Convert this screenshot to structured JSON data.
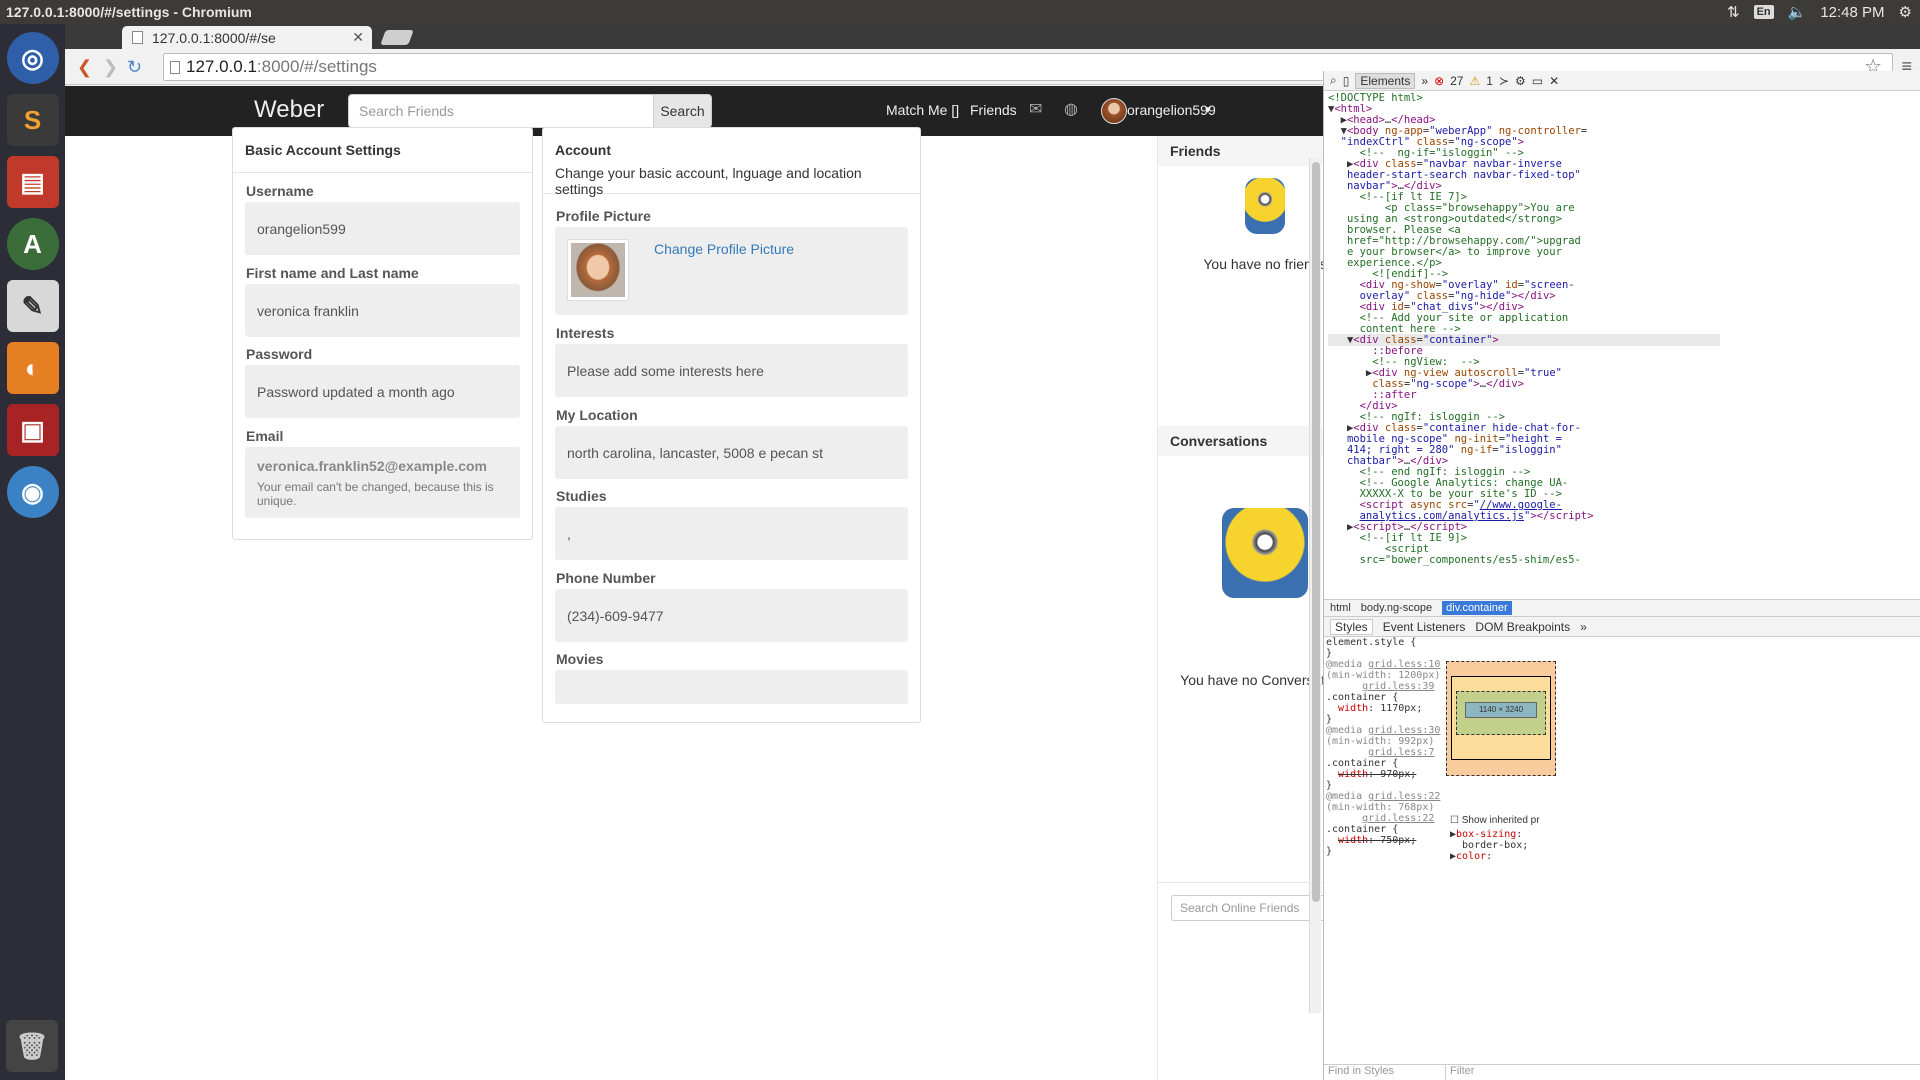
{
  "window": {
    "title": "127.0.0.1:8000/#/settings - Chromium",
    "time": "12:48 PM",
    "kbd": "En"
  },
  "browser": {
    "tab_title": "127.0.0.1:8000/#/se",
    "url_host": "127.0.0.1",
    "url_rest": ":8000/#/settings"
  },
  "navbar": {
    "brand": "Weber",
    "search_placeholder": "Search Friends",
    "search_button": "Search",
    "match_me": "Match Me []",
    "friends": "Friends",
    "username": "orangelion599"
  },
  "basic": {
    "title": "Basic Account Settings",
    "fields": [
      {
        "label": "Username",
        "value": "orangelion599"
      },
      {
        "label": "First name and Last name",
        "value": "veronica franklin"
      },
      {
        "label": "Password",
        "value": "Password updated a month ago"
      },
      {
        "label": "Email",
        "value": "veronica.franklin52@example.com",
        "note": "Your email can't be changed, because this is unique."
      }
    ]
  },
  "account": {
    "title": "Account",
    "subtitle": "Change your basic account, lnguage and location settings",
    "picture_label": "Profile Picture",
    "change_picture": "Change Profile Picture",
    "fields": [
      {
        "label": "Interests",
        "value": "Please add some interests here"
      },
      {
        "label": "My Location",
        "value": "north carolina, lancaster, 5008 e pecan st"
      },
      {
        "label": "Studies",
        "value": ","
      },
      {
        "label": "Phone Number",
        "value": "(234)-609-9477"
      },
      {
        "label": "Movies",
        "value": ""
      }
    ]
  },
  "sidebar": {
    "friends_title": "Friends",
    "friends_empty": "You have no friends",
    "conv_title": "Conversations",
    "conv_empty": "You have no Conversations",
    "online_placeholder": "Search Online Friends"
  },
  "devtools": {
    "tab": "Elements",
    "errors": "27",
    "warnings": "1",
    "breadcrumbs": [
      "html",
      "body.ng-scope",
      "div.container"
    ],
    "style_tabs": [
      "Styles",
      "Event Listeners",
      "DOM Breakpoints"
    ],
    "box": "1140 × 3240",
    "find": "Find in Styles",
    "filter": "Filter",
    "show_inherited": "Show inherited pr"
  }
}
